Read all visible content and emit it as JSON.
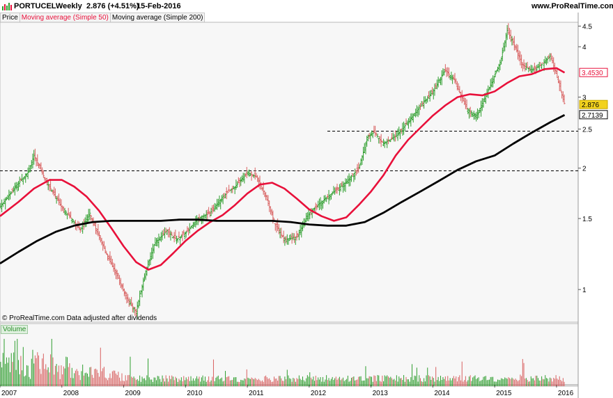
{
  "header": {
    "symbol": "PORTUCEL",
    "period": "Weekly",
    "quote": "2.876 (+4.51%)",
    "date": "15-Feb-2016",
    "site": "www.ProRealTime.com"
  },
  "legend": {
    "price": "Price",
    "ma50": "Moving average (Simple 50)",
    "ma200": "Moving average (Simple 200)"
  },
  "footer": {
    "note": "© ProRealTime.com  Data adjusted after dividends",
    "volume_label": "Volume"
  },
  "colors": {
    "up": "#2e9e2e",
    "down": "#d86060",
    "ma50": "#e8103a",
    "ma200": "#000000",
    "price_tag": "#f2d21e"
  },
  "chart_data": {
    "type": "line",
    "title": "PORTUCEL Weekly",
    "scale": "log",
    "ylim": [
      0.83,
      4.6
    ],
    "y_ticks": [
      "4.5",
      "4",
      "3",
      "2.5",
      "2",
      "1.5",
      "1"
    ],
    "x_ticks": [
      "2007",
      "2008",
      "2009",
      "2010",
      "2011",
      "2012",
      "2013",
      "2014",
      "2015",
      "2016"
    ],
    "last_values": {
      "ma50": "3.4530",
      "price": "2.876",
      "ma200": "2.7139"
    },
    "support_lines": [
      2.47,
      1.97
    ],
    "series": [
      {
        "name": "Price",
        "x": [
          2007.0,
          2007.25,
          2007.45,
          2007.55,
          2007.75,
          2008.0,
          2008.15,
          2008.3,
          2008.45,
          2008.6,
          2008.75,
          2008.9,
          2009.05,
          2009.2,
          2009.35,
          2009.5,
          2009.7,
          2009.85,
          2010.0,
          2010.2,
          2010.4,
          2010.6,
          2010.8,
          2011.0,
          2011.15,
          2011.3,
          2011.45,
          2011.6,
          2011.8,
          2012.0,
          2012.2,
          2012.4,
          2012.6,
          2012.8,
          2012.95,
          2013.05,
          2013.2,
          2013.4,
          2013.6,
          2013.8,
          2014.0,
          2014.2,
          2014.35,
          2014.55,
          2014.7,
          2014.85,
          2015.0,
          2015.1,
          2015.2,
          2015.3,
          2015.45,
          2015.6,
          2015.75,
          2015.9,
          2016.0,
          2016.13
        ],
        "values": [
          1.6,
          1.8,
          1.95,
          2.15,
          1.85,
          1.6,
          1.5,
          1.4,
          1.55,
          1.35,
          1.2,
          1.08,
          0.95,
          0.88,
          1.1,
          1.3,
          1.4,
          1.33,
          1.38,
          1.5,
          1.55,
          1.7,
          1.8,
          1.95,
          1.9,
          1.7,
          1.45,
          1.33,
          1.35,
          1.55,
          1.65,
          1.75,
          1.85,
          2.0,
          2.4,
          2.45,
          2.3,
          2.4,
          2.6,
          2.85,
          3.1,
          3.5,
          3.3,
          2.8,
          2.7,
          3.0,
          3.4,
          3.7,
          4.4,
          4.1,
          3.6,
          3.5,
          3.6,
          3.8,
          3.4,
          2.876
        ]
      },
      {
        "name": "Moving average (Simple 50)",
        "x": [
          2007.0,
          2007.3,
          2007.55,
          2007.8,
          2008.0,
          2008.2,
          2008.4,
          2008.6,
          2008.8,
          2009.0,
          2009.2,
          2009.4,
          2009.6,
          2009.8,
          2010.0,
          2010.2,
          2010.4,
          2010.6,
          2010.8,
          2011.0,
          2011.2,
          2011.4,
          2011.6,
          2011.8,
          2012.0,
          2012.2,
          2012.4,
          2012.6,
          2012.8,
          2013.0,
          2013.2,
          2013.4,
          2013.6,
          2013.8,
          2014.0,
          2014.2,
          2014.4,
          2014.6,
          2014.8,
          2015.0,
          2015.2,
          2015.4,
          2015.6,
          2015.8,
          2016.0,
          2016.13
        ],
        "values": [
          1.52,
          1.65,
          1.78,
          1.87,
          1.87,
          1.8,
          1.7,
          1.57,
          1.42,
          1.28,
          1.17,
          1.12,
          1.15,
          1.23,
          1.32,
          1.4,
          1.47,
          1.53,
          1.62,
          1.73,
          1.82,
          1.84,
          1.78,
          1.68,
          1.58,
          1.52,
          1.48,
          1.51,
          1.62,
          1.75,
          1.92,
          2.15,
          2.35,
          2.52,
          2.7,
          2.86,
          3.0,
          3.05,
          3.03,
          3.1,
          3.25,
          3.38,
          3.42,
          3.52,
          3.54,
          3.45
        ]
      },
      {
        "name": "Moving average (Simple 200)",
        "x": [
          2007.0,
          2007.3,
          2007.6,
          2007.9,
          2008.2,
          2008.5,
          2008.8,
          2009.0,
          2009.3,
          2009.6,
          2009.9,
          2010.2,
          2010.5,
          2010.8,
          2011.1,
          2011.4,
          2011.7,
          2012.0,
          2012.3,
          2012.6,
          2012.9,
          2013.2,
          2013.5,
          2013.8,
          2014.1,
          2014.4,
          2014.7,
          2015.0,
          2015.3,
          2015.6,
          2015.9,
          2016.13
        ],
        "values": [
          1.16,
          1.24,
          1.32,
          1.39,
          1.44,
          1.47,
          1.48,
          1.48,
          1.48,
          1.48,
          1.49,
          1.49,
          1.48,
          1.48,
          1.48,
          1.48,
          1.47,
          1.45,
          1.44,
          1.44,
          1.47,
          1.55,
          1.65,
          1.75,
          1.86,
          1.98,
          2.08,
          2.15,
          2.3,
          2.45,
          2.6,
          2.71
        ]
      }
    ]
  }
}
